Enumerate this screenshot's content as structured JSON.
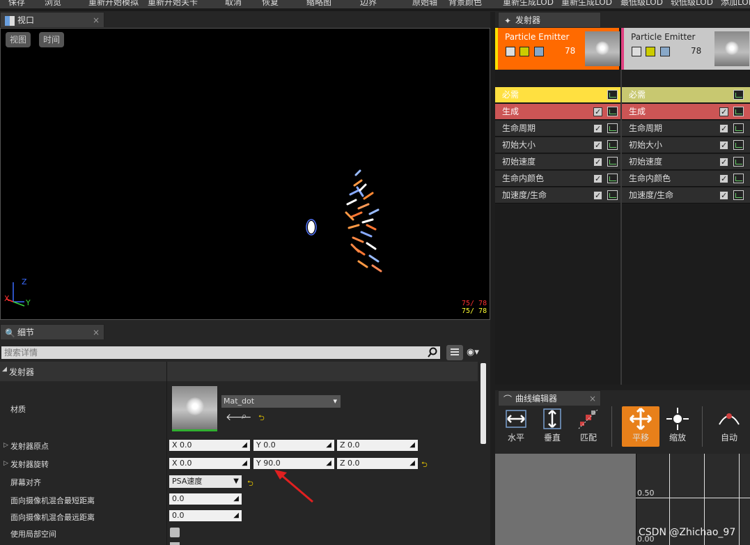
{
  "toolbar": {
    "items": [
      "保存",
      "浏览",
      "重新开始模拟",
      "重新开始关卡",
      "取消",
      "恢复",
      "缩略图",
      "边界",
      "原始轴",
      "背景颜色",
      "重新生成LOD",
      "重新生成LOD",
      "最低级LOD",
      "较低级LOD",
      "添加LOD"
    ]
  },
  "viewport": {
    "tab_label": "视口",
    "view_button": "视图",
    "time_button": "时间",
    "stat_red": "75/ 78",
    "stat_yellow": "75/ 78",
    "axis_z": "Z",
    "axis_x": "X",
    "axis_y": "Y"
  },
  "emitters": {
    "tab_label": "发射器",
    "cards": [
      {
        "name": "Particle Emitter",
        "count": "78",
        "color": "#ff6a00"
      },
      {
        "name": "Particle Emitter",
        "count": "78",
        "color": "#c8c8c8"
      }
    ],
    "modules": [
      "必需",
      "生成",
      "生命周期",
      "初始大小",
      "初始速度",
      "生命内颜色",
      "加速度/生命"
    ]
  },
  "details": {
    "tab_label": "细节",
    "search_placeholder": "搜索详情",
    "section": "发射器",
    "material_label": "材质",
    "material_value": "Mat_dot",
    "rows": [
      {
        "label": "发射器原点",
        "x": "X  0.0",
        "y": "Y  0.0",
        "z": "Z  0.0"
      },
      {
        "label": "发射器旋转",
        "x": "X  0.0",
        "y": "Y  90.0",
        "z": "Z  0.0"
      }
    ],
    "screen_align_label": "屏幕对齐",
    "screen_align_value": "PSA速度",
    "min_dist_label": "面向摄像机混合最短距离",
    "min_dist_value": "0.0",
    "max_dist_label": "面向摄像机混合最远距离",
    "max_dist_value": "0.0",
    "local_space_label": "使用局部空间"
  },
  "curve_editor": {
    "tab_label": "曲线编辑器",
    "tools": [
      "水平",
      "垂直",
      "匹配",
      "平移",
      "缩放",
      "自动"
    ],
    "tick_050": "0.50",
    "tick_000": "0.00"
  },
  "watermark": "CSDN @Zhichao_97"
}
